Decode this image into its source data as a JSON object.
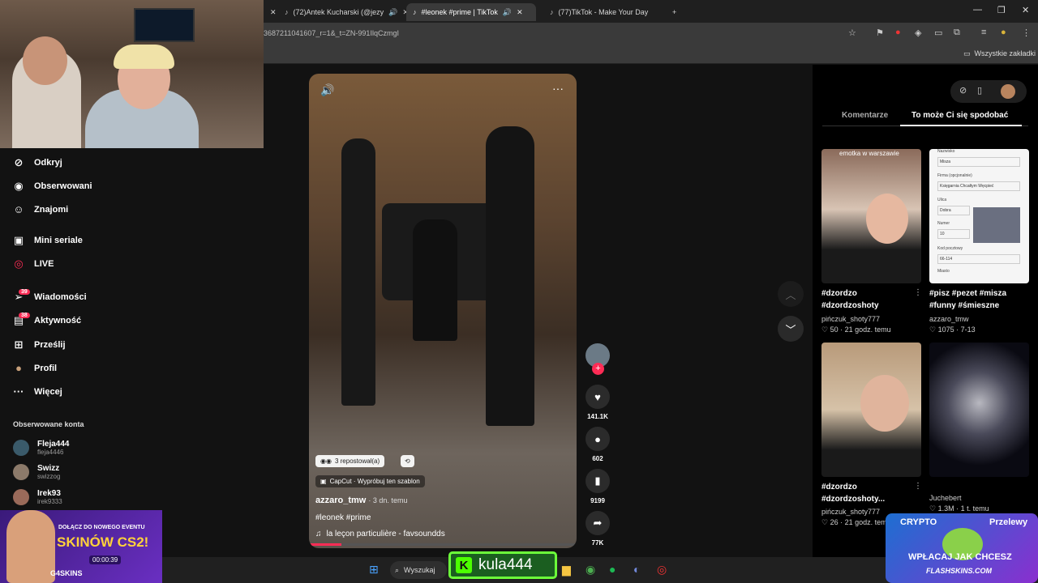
{
  "browser": {
    "tabs": [
      {
        "label": "(72)Antek Kucharski (@jezy"
      },
      {
        "label": "#leonek #prime | TikTok"
      },
      {
        "label": "(77)TikTok - Make Your Day"
      }
    ],
    "url": "3687211041607_r=1&_t=ZN-991IlqCzmgI",
    "bookmarks_label": "Wszystkie zakładki"
  },
  "sidebar": {
    "items": [
      {
        "label": "Odkryj",
        "icon": "compass-icon"
      },
      {
        "label": "Obserwowani",
        "icon": "avatar-icon"
      },
      {
        "label": "Znajomi",
        "icon": "friends-icon"
      },
      {
        "label": "Mini seriale",
        "icon": "film-icon"
      },
      {
        "label": "LIVE",
        "icon": "live-icon"
      },
      {
        "label": "Wiadomości",
        "icon": "send-icon",
        "badge": "39"
      },
      {
        "label": "Aktywność",
        "icon": "inbox-icon",
        "badge": "38"
      },
      {
        "label": "Prześlij",
        "icon": "plus-icon"
      },
      {
        "label": "Profil",
        "icon": "profile-icon"
      },
      {
        "label": "Więcej",
        "icon": "more-icon"
      }
    ],
    "followed_heading": "Obserwowane konta",
    "accounts": [
      {
        "name": "Fleja444",
        "handle": "fleja4446"
      },
      {
        "name": "Swizz",
        "handle": "swizzog"
      },
      {
        "name": "Irek93",
        "handle": "irek9333"
      }
    ]
  },
  "video": {
    "reposted": "3 repostował(a)",
    "template": "CapCut · Wypróbuj ten szablon",
    "author": "azzaro_tmw",
    "age": "· 3 dn. temu",
    "hashtags": "#leonek #prime",
    "music": "la leçon particulière - favsoundds",
    "likes": "141.1K",
    "comments": "602",
    "saves": "9199",
    "shares": "77K"
  },
  "panel": {
    "tab_comments": "Komentarze",
    "tab_suggested": "To może Ci się spodobać",
    "cards": [
      {
        "overlay": "emotka w warszawie",
        "caption": "#dzordzo #dzordzoshoty",
        "user": "pińczuk_shoty777",
        "stats": "♡ 50 · 21 godz. temu"
      },
      {
        "overlay": "",
        "caption": "#pisz #pezet #misza #funny #śmieszne",
        "user": "azzaro_tmw",
        "stats": "♡ 1075 · 7-13"
      },
      {
        "overlay": "",
        "caption": "#dzordzo #dzordzoshoty...",
        "user": "pińczuk_shoty777",
        "stats": "♡ 26 · 21 godz. temu"
      },
      {
        "overlay": "",
        "caption": "",
        "user": "Juchebert",
        "stats": "♡ 1.3M · 1 t. temu"
      }
    ],
    "form_labels": [
      "Nazwisko",
      "Misza",
      "Firma (opcjonalnie)",
      "Księgarnia Chcałtym Węcpieć",
      "Ulica",
      "Dobra",
      "Numer",
      "10",
      "Kod pocztowy",
      "66-114",
      "Miasto"
    ]
  },
  "taskbar": {
    "search_label": "Wyszukaj"
  },
  "overlays": {
    "streamer_name": "kula444",
    "promo_left_line1": "DOŁĄCZ DO NOWEGO EVENTU",
    "promo_left_line2": "SKINÓW CS2!",
    "promo_left_timer": "00:00:39",
    "promo_left_brand": "G4SKINS",
    "promo_right_top": "CRYPTO",
    "promo_right_top2": "Przelewy",
    "promo_right_main": "WPŁACAJ JAK CHCESZ",
    "promo_right_brand": "FLASHSKINS.COM"
  }
}
